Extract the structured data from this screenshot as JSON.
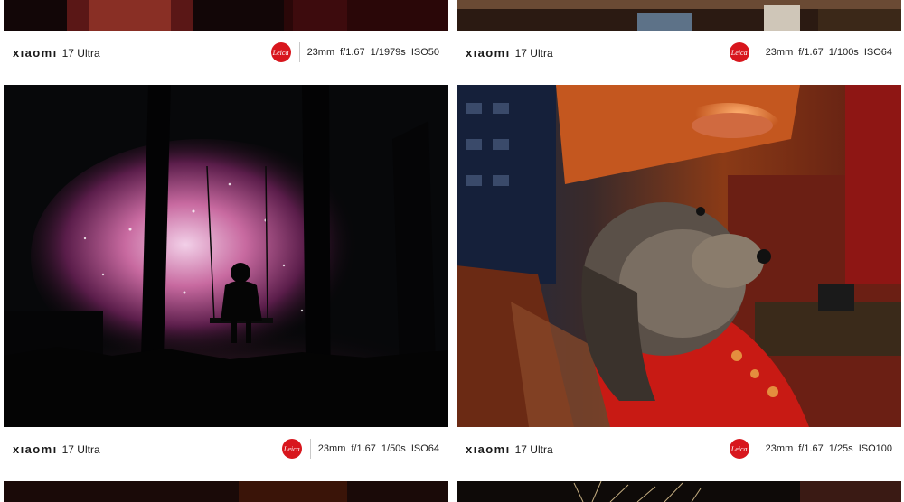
{
  "cards": [
    {
      "brand": "xıaomı",
      "model": "17 Ultra",
      "focal": "23mm",
      "aperture": "f/1.67",
      "shutter": "1/1979s",
      "iso": "ISO50",
      "leica": "Leica"
    },
    {
      "brand": "xıaomı",
      "model": "17 Ultra",
      "focal": "23mm",
      "aperture": "f/1.67",
      "shutter": "1/100s",
      "iso": "ISO64",
      "leica": "Leica"
    },
    {
      "brand": "xıaomı",
      "model": "17 Ultra",
      "focal": "23mm",
      "aperture": "f/1.67",
      "shutter": "1/50s",
      "iso": "ISO64",
      "leica": "Leica"
    },
    {
      "brand": "xıaomı",
      "model": "17 Ultra",
      "focal": "23mm",
      "aperture": "f/1.67",
      "shutter": "1/25s",
      "iso": "ISO100",
      "leica": "Leica"
    }
  ],
  "colors": {
    "leica_red": "#d8161d",
    "caption_bg": "#ffffff"
  }
}
